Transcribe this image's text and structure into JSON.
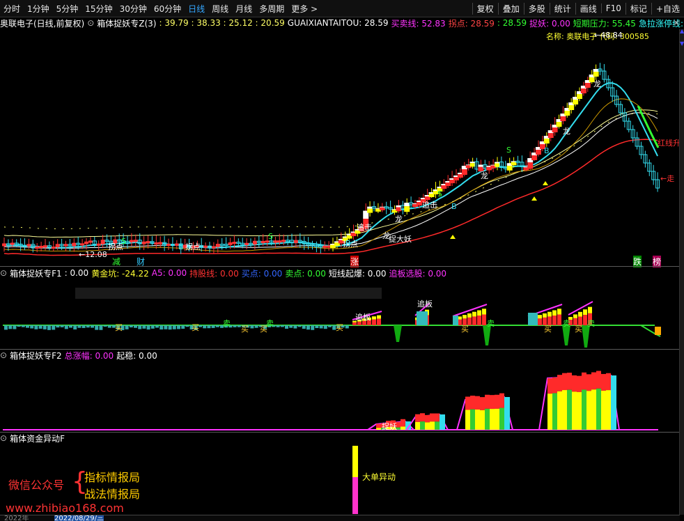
{
  "toolbar": {
    "periods": [
      "分时",
      "1分钟",
      "5分钟",
      "15分钟",
      "30分钟",
      "60分钟",
      "日线",
      "周线",
      "月线",
      "多周期",
      "更多 >"
    ],
    "active_period": "日线",
    "right_buttons": [
      "复权",
      "叠加",
      "多股",
      "统计",
      "画线",
      "F10",
      "标记",
      "+自选"
    ]
  },
  "main_panel": {
    "stock_name": "奥联电子(日线,前复权)",
    "indicator_name": "箱体捉妖专Z(3)",
    "values_text": ": 39.79 : 38.33 : 25.12 : 20.59",
    "gx_label": "GUAIXIANTAITOU: 28.59",
    "mmx_label": "买卖线: 52.83",
    "gd_label": "拐点: 28.59",
    "v2": ": 28.59",
    "zy_label": "捉妖: 0.00",
    "dq_label": "短期压力: 55.45",
    "jl_label": "急拉涨停线:",
    "name_label": "名称: 奥联电子 代码: 300585",
    "low_price": "←12.08",
    "annotations": [
      "拐点",
      "拐点",
      "拐点",
      "追击",
      "龙",
      "龙",
      "捉大妖",
      "追击",
      "龙",
      "龙",
      "龙",
      "S",
      "S",
      "S",
      "B",
      "B",
      "B",
      "B",
      "S"
    ],
    "bottom_marks": [
      "减",
      "财",
      "涨",
      "跌",
      "榜"
    ],
    "right_labels": [
      "红线升",
      "←走"
    ],
    "high_label": "←48.84"
  },
  "f1_panel": {
    "name": "箱体捉妖专F1",
    "value": ": 0.00",
    "hjk": "黄金坑: -24.22",
    "a5": "A5: 0.00",
    "cgx": "持股线: 0.00",
    "md": "买点: 0.00",
    "maid": "卖点: 0.00",
    "dxqb": "短线起爆: 0.00",
    "zbxg": "追板选股: 0.00",
    "marks": [
      "买",
      "买",
      "卖",
      "买",
      "卖",
      "买",
      "买",
      "追板",
      "追板",
      "买",
      "卖",
      "买",
      "卖",
      "买",
      "卖"
    ]
  },
  "f2_panel": {
    "name": "箱体捉妖专F2",
    "zzf": "总涨幅: 0.00",
    "qw": "起稳: 0.00",
    "marks": [
      "捉妖",
      "准"
    ]
  },
  "f3_panel": {
    "name": "箱体资金异动F",
    "mark": "大单异动"
  },
  "watermark": {
    "line1_left": "微信公众号",
    "line1_right": "指标情报局",
    "line2_right": "战法情报局",
    "url": "www.zhibiao168.com"
  },
  "date_axis": [
    "2022年",
    "2022/08/29/三"
  ],
  "colors": {
    "red": "#ff2a2a",
    "yellow": "#ffff00",
    "cyan": "#33ddee",
    "green": "#00cc00",
    "magenta": "#ff33ff",
    "white": "#ffffff",
    "bg": "#000000"
  }
}
